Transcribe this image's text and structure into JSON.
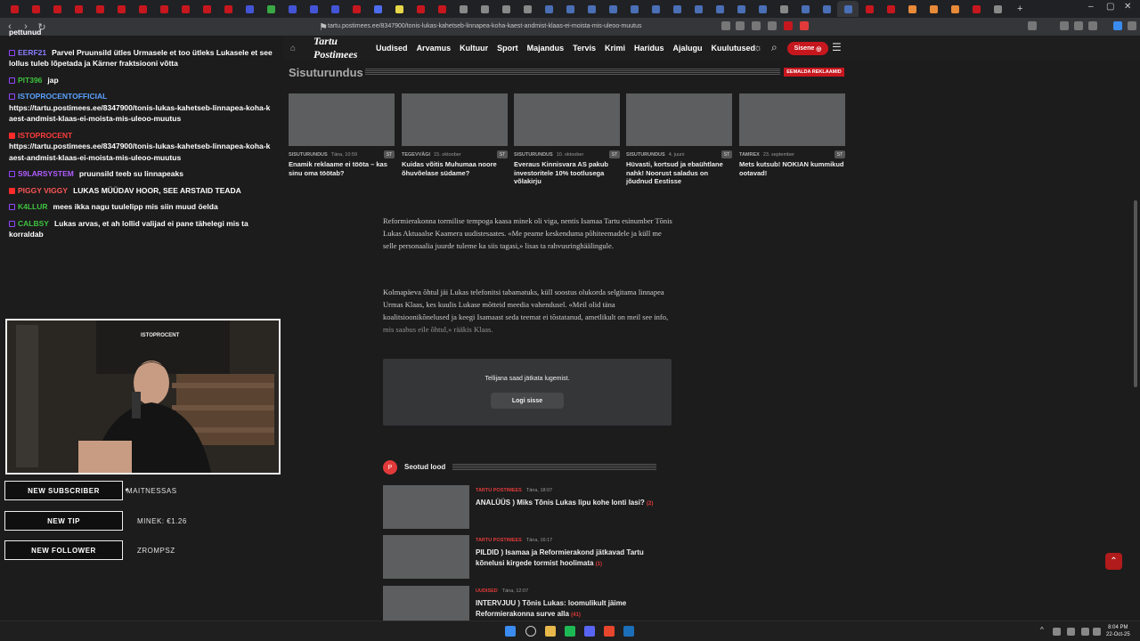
{
  "browser": {
    "url": "tartu.postimees.ee/8347900/tonis-lukas-kahetseb-linnapea-koha-kaest-andmist-klaas-ei-moista-mis-uleoo-muutus",
    "tab_colors": [
      "#c7171e",
      "#c7171e",
      "#c7171e",
      "#c7171e",
      "#c7171e",
      "#c7171e",
      "#c7171e",
      "#c7171e",
      "#c7171e",
      "#c7171e",
      "#c7171e",
      "#4355d6",
      "#39a845",
      "#4355d6",
      "#4355d6",
      "#4355d6",
      "#c7171e",
      "#4d6cf0",
      "#e6d84a",
      "#c7171e",
      "#c7171e",
      "#888",
      "#888",
      "#888",
      "#888",
      "#4a6fb5",
      "#4a6fb5",
      "#4a6fb5",
      "#4a6fb5",
      "#4a6fb5",
      "#4a6fb5",
      "#4a6fb5",
      "#4a6fb5",
      "#4a6fb5",
      "#4a6fb5",
      "#4a6fb5",
      "#888",
      "#4a6fb5",
      "#4a6fb5",
      "#4a6fb5",
      "#c7171e",
      "#c7171e",
      "#e98a38",
      "#e98a38",
      "#e98a38",
      "#c7171e",
      "#888"
    ]
  },
  "site": {
    "logo": "Tartu Postimees",
    "nav": [
      "Uudised",
      "Arvamus",
      "Kultuur",
      "Sport",
      "Majandus",
      "Tervis",
      "Krimi",
      "Haridus",
      "Ajalugu",
      "Kuulutused"
    ],
    "signin": "Sisene"
  },
  "chat": {
    "top_fragment": "pettunud",
    "messages": [
      {
        "user": "EERF21",
        "color": "#8a7dff",
        "platform": "twitch",
        "text": "Parvel Pruunsild ütles Urmasele et too ütleks Lukasele et see lollus tuleb lõpetada ja Kärner fraktsiooni võtta"
      },
      {
        "user": "PIT396",
        "color": "#3ec23e",
        "platform": "twitch",
        "text": "jap"
      },
      {
        "user": "ISTOPROCENTOFFICIAL",
        "color": "#5aa0ff",
        "platform": "twitch",
        "text": "https://tartu.postimees.ee/8347900/tonis-lukas-kahetseb-linnapea-koha-kaest-andmist-klaas-ei-moista-mis-uleoo-muutus"
      },
      {
        "user": "ISTOPROCENT",
        "color": "#ff3b3b",
        "platform": "youtube",
        "text": "https://tartu.postimees.ee/8347900/tonis-lukas-kahetseb-linnapea-koha-kaest-andmist-klaas-ei-moista-mis-uleoo-muutus"
      },
      {
        "user": "S9LARSYSTEM",
        "color": "#b05cff",
        "platform": "twitch",
        "text": "pruunsild teeb su linnapeaks"
      },
      {
        "user": "PIGGY VIGGY",
        "color": "#ff5555",
        "platform": "youtube",
        "text": "LUKAS MÜÜDAV HOOR, SEE ARSTAID TEADA"
      },
      {
        "user": "K4LLUR",
        "color": "#3ec23e",
        "platform": "twitch",
        "text": "mees ikka nagu tuulelipp mis siin muud öelda"
      },
      {
        "user": "CALBSY",
        "color": "#3ec23e",
        "platform": "twitch",
        "text": "Lukas arvas, et ah lollid valijad ei pane tähelegi mis ta korraldab"
      }
    ]
  },
  "overlay": {
    "cam_label": "ISTOPROCENT",
    "alerts": [
      {
        "label": "NEW SUBSCRIBER",
        "value": "MAITNESSAS"
      },
      {
        "label": "NEW TIP",
        "value": "MINEK: €1.26"
      },
      {
        "label": "NEW FOLLOWER",
        "value": "ZROMPSZ"
      }
    ]
  },
  "ads": {
    "title": "Sisuturundus",
    "remove": "EEMALDA REKLAAMID",
    "cards": [
      {
        "source": "SISUTURUNDUS",
        "date": "Täna, 10:59",
        "badge": "ST",
        "headline": "Enamik reklaame ei tööta – kas sinu oma töötab?"
      },
      {
        "source": "TEGEVVÄGI",
        "date": "15. oktoober",
        "badge": "ST",
        "headline": "Kuidas võitis Muhumaa noore õhuvõelase südame?"
      },
      {
        "source": "SISUTURUNDUS",
        "date": "10. oktoober",
        "badge": "ST",
        "headline": "Everaus Kinnisvara AS pakub investoritele 10% tootlusega võlakirju"
      },
      {
        "source": "SISUTURUNDUS",
        "date": "4. juuni",
        "badge": "ST",
        "headline": "Hüvasti, kortsud ja ebaühtlane nahk! Noorust saladus on jõudnud Eestisse"
      },
      {
        "source": "TAMREX",
        "date": "23. september",
        "badge": "ST",
        "headline": "Mets kutsub! NOKIAN kummikud ootavad!"
      }
    ]
  },
  "article": {
    "para1": "Reformierakonna tormilise tempoga kaasa minek oli viga, nentis Isamaa Tartu esinumber Tõnis Lukas Aktuaalse Kaamera uudistesaates. «Me peame keskenduma põhiteemadele ja küll me selle personaalia juurde tuleme ka siis tagasi,» lisas ta rahvusringhäälingule.",
    "para2": "Kolmapäeva õhtul jäi Lukas telefonitsi tabamatuks, küll soostus olukorda selgitama linnapea Urmas Klaas, kes kuulis Lukase mõtteid meedia vahendusel. «Meil olid täna koalitsioonikõnelused ja keegi Isamaast seda teemat ei tõstatanud, ametlikult on meil see info, mis saabus eile õhtul,» rääkis Klaas.",
    "paywall": "Tellijana saad jätkata lugemist.",
    "login": "Logi sisse"
  },
  "related": {
    "title": "Seotud lood",
    "items": [
      {
        "source": "TARTU POSTIMEES",
        "time": "Täna, 18:07",
        "headline": "ANALÜÜS ) Miks Tõnis Lukas lipu kohe lonti lasi?",
        "count": "(2)"
      },
      {
        "source": "TARTU POSTIMEES",
        "time": "Täna, 16:17",
        "headline": "PILDID ) Isamaa ja Reformierakond jätkavad Tartu kõnelusi kirgede tormist hoolimata",
        "count": "(1)"
      },
      {
        "source": "UUDISED",
        "time": "Täna, 12:07",
        "headline": "INTERVJUU ) Tõnis Lukas: loomulikult jäime Reformierakonna surve alla",
        "count": "(41)"
      }
    ]
  },
  "taskbar": {
    "time": "8:04 PM",
    "date": "22-Oct-25"
  }
}
